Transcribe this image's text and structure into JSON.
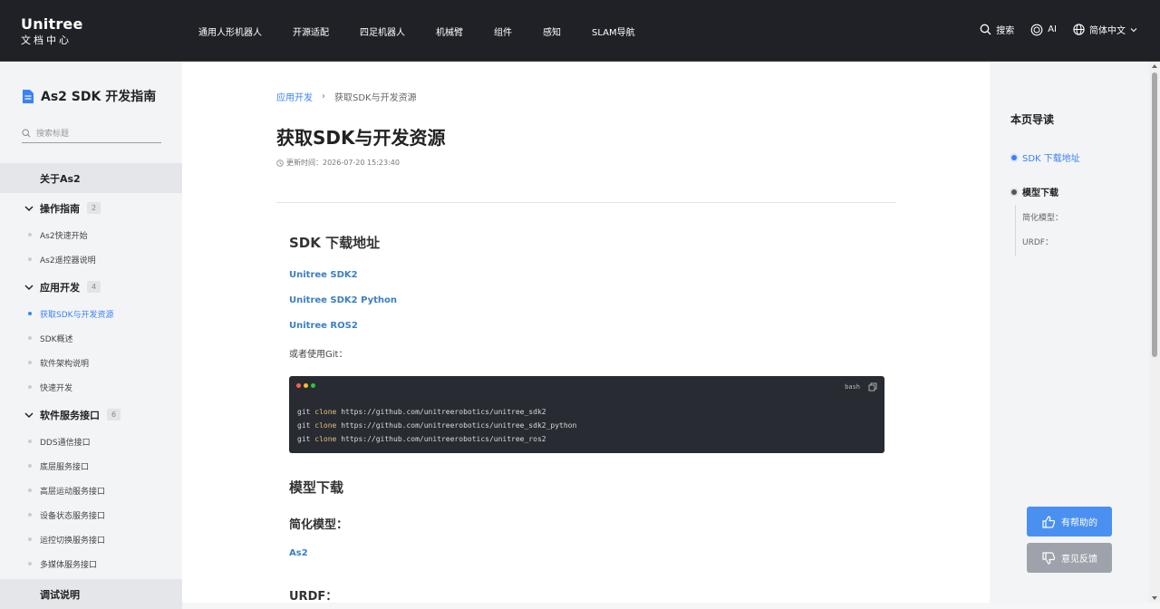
{
  "header": {
    "logo_line1": "Unitree",
    "logo_line2": "文档中心",
    "nav": [
      "通用人形机器人",
      "开源适配",
      "四足机器人",
      "机械臂",
      "组件",
      "感知",
      "SLAM导航"
    ],
    "search_label": "搜索",
    "ai_label": "AI",
    "language_label": "简体中文"
  },
  "sidebar": {
    "title": "As2 SDK 开发指南",
    "search_placeholder": "搜索标题",
    "about": "关于As2",
    "groups": [
      {
        "label": "操作指南",
        "count": "2",
        "items": [
          "As2快速开始",
          "As2遥控器说明"
        ]
      },
      {
        "label": "应用开发",
        "count": "4",
        "items": [
          "获取SDK与开发资源",
          "SDK概述",
          "软件架构说明",
          "快速开发"
        ]
      },
      {
        "label": "软件服务接口",
        "count": "6",
        "items": [
          "DDS通信接口",
          "底层服务接口",
          "高层运动服务接口",
          "设备状态服务接口",
          "运控切换服务接口",
          "多媒体服务接口"
        ]
      }
    ],
    "debug": "调试说明",
    "active_item": "获取SDK与开发资源"
  },
  "main": {
    "breadcrumb": [
      "应用开发",
      "获取SDK与开发资源"
    ],
    "title": "获取SDK与开发资源",
    "updated": "更新时间：2026-07-20 15:23:40",
    "section1_title": "SDK 下载地址",
    "links": [
      "Unitree SDK2",
      "Unitree SDK2 Python",
      "Unitree ROS2"
    ],
    "git_text": "或者使用Git：",
    "code": {
      "lang": "bash",
      "lines": [
        {
          "cmd": "git",
          "kw": "clone",
          "url": "https://github.com/unitreerobotics/unitree_sdk2"
        },
        {
          "cmd": "git",
          "kw": "clone",
          "url": "https://github.com/unitreerobotics/unitree_sdk2_python"
        },
        {
          "cmd": "git",
          "kw": "clone",
          "url": "https://github.com/unitreerobotics/unitree_ros2"
        }
      ]
    },
    "section2_title": "模型下载",
    "subsection1_title": "简化模型：",
    "model_link": "As2",
    "subsection2_title": "URDF："
  },
  "toc": {
    "title": "本页导读",
    "items": [
      "SDK 下载地址",
      "模型下载"
    ],
    "subitems": [
      "简化模型：",
      "URDF："
    ]
  },
  "feedback": {
    "helpful": "有帮助的",
    "feedback": "意见反馈"
  },
  "colors": {
    "accent": "#3b82f6",
    "topbar": "#1f2126",
    "helpful_btn": "#4a90f0",
    "feedback_btn": "#9ea3ab"
  }
}
